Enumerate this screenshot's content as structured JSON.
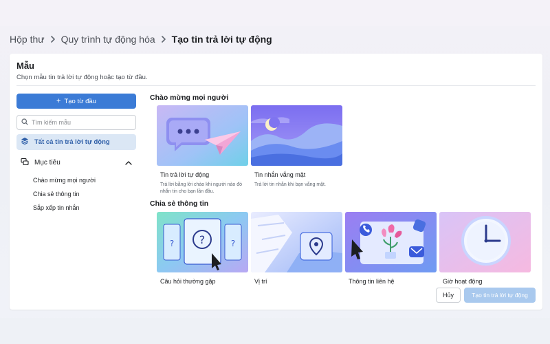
{
  "breadcrumb": {
    "items": [
      "Hộp thư",
      "Quy trình tự động hóa"
    ],
    "current": "Tạo tin trả lời tự động"
  },
  "panel": {
    "title": "Mẫu",
    "subtitle": "Chọn mẫu tin trả lời tự động hoặc tạo từ đầu."
  },
  "sidebar": {
    "create_label": "Tạo từ đầu",
    "search_placeholder": "Tìm kiếm mẫu",
    "all_label": "Tất cả tin trả lời tự động",
    "section_label": "Mục tiêu",
    "sub_items": [
      "Chào mừng mọi người",
      "Chia sẻ thông tin",
      "Sắp xếp tin nhắn"
    ]
  },
  "groups": [
    {
      "title": "Chào mừng mọi người",
      "cards": [
        {
          "name": "Tin trả lời tự động",
          "desc": "Trả lời bằng lời chào khi người nào đó nhắn tin cho bạn lần đầu.",
          "icon": "chat-bubble-paper-plane-illustration"
        },
        {
          "name": "Tin nhắn vắng mặt",
          "desc": "Trả lời tin nhắn khi bạn vắng mặt.",
          "icon": "moon-mountains-illustration"
        }
      ]
    },
    {
      "title": "Chia sẻ thông tin",
      "cards": [
        {
          "name": "Câu hỏi thường gặp",
          "icon": "question-cards-illustration"
        },
        {
          "name": "Vị trí",
          "icon": "map-pin-illustration"
        },
        {
          "name": "Thông tin liên hệ",
          "icon": "contact-info-illustration"
        },
        {
          "name": "Giờ hoạt động",
          "icon": "clock-illustration"
        }
      ]
    }
  ],
  "footer": {
    "cancel_label": "Hủy",
    "submit_label": "Tạo tin trả lời tự động"
  },
  "colors": {
    "primary": "#3b7bd6",
    "selected_bg": "#dbe7f5",
    "disabled_primary": "#a9c9ee"
  }
}
